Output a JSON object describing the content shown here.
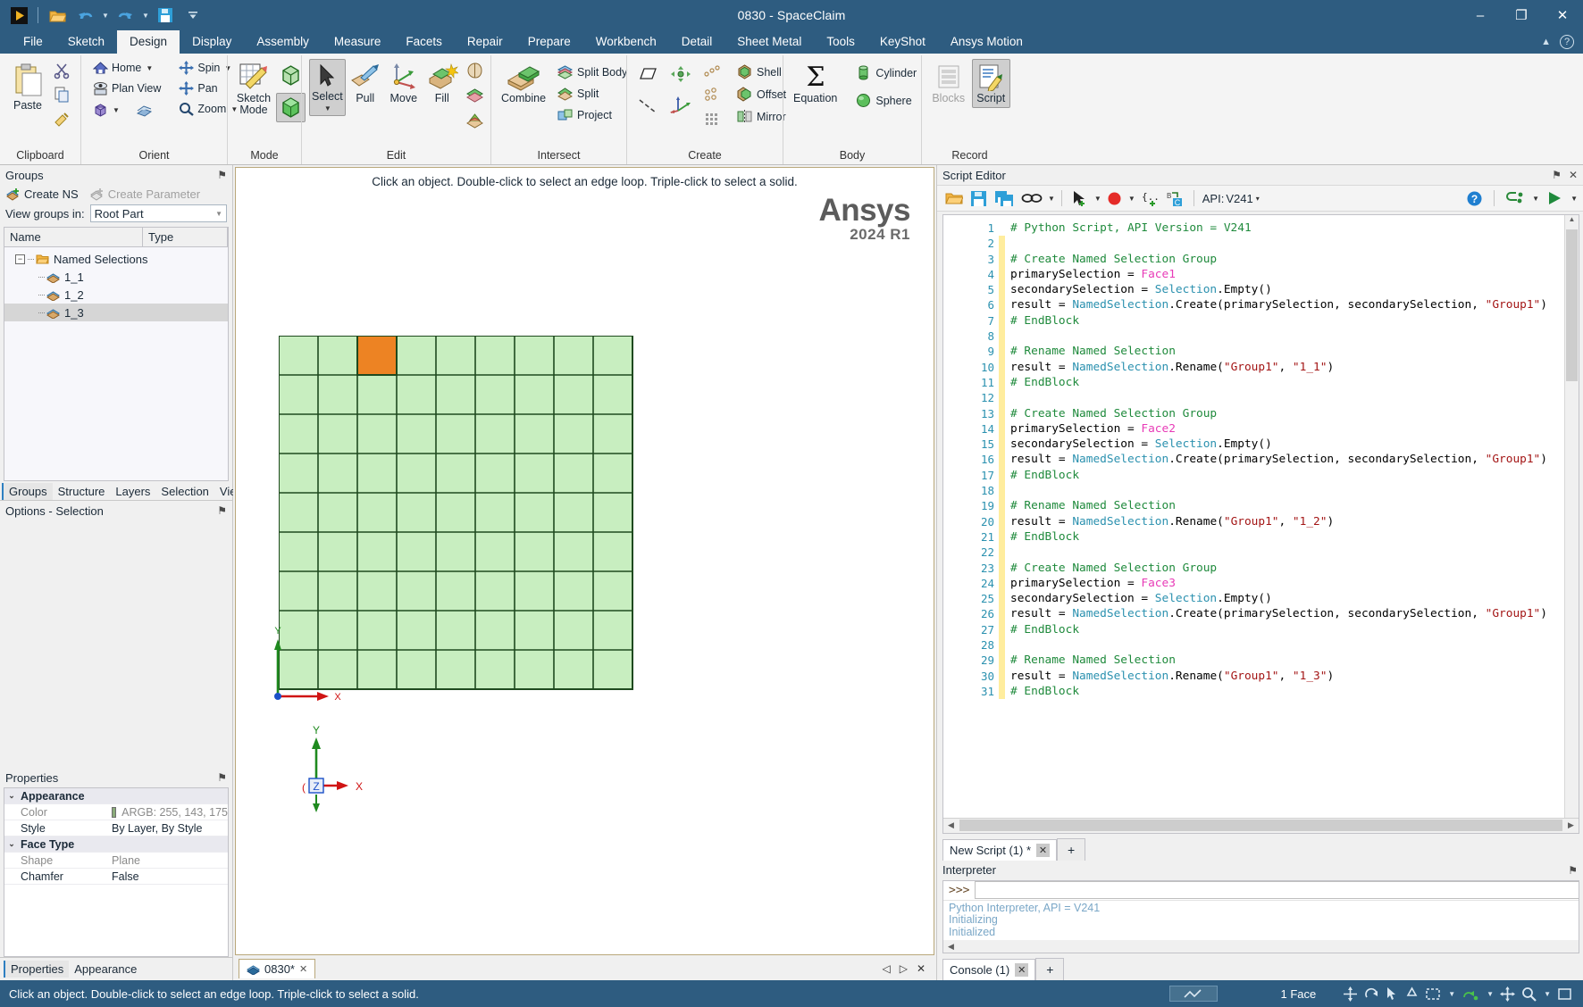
{
  "window": {
    "title": "0830 - SpaceClaim",
    "minimize": "–",
    "maximize": "❐",
    "close": "✕"
  },
  "quick_access": [
    {
      "name": "app-menu-icon",
      "label": "▶"
    },
    {
      "name": "open-icon",
      "label": "folder"
    },
    {
      "name": "undo-icon",
      "label": "undo"
    },
    {
      "name": "redo-icon",
      "label": "redo"
    },
    {
      "name": "save-icon",
      "label": "save"
    },
    {
      "name": "customize-qat-icon",
      "label": "more"
    }
  ],
  "ribbon": {
    "tabs": [
      {
        "label": "File",
        "active": false
      },
      {
        "label": "Sketch",
        "active": false
      },
      {
        "label": "Design",
        "active": true
      },
      {
        "label": "Display",
        "active": false
      },
      {
        "label": "Assembly",
        "active": false
      },
      {
        "label": "Measure",
        "active": false
      },
      {
        "label": "Facets",
        "active": false
      },
      {
        "label": "Repair",
        "active": false
      },
      {
        "label": "Prepare",
        "active": false
      },
      {
        "label": "Workbench",
        "active": false
      },
      {
        "label": "Detail",
        "active": false
      },
      {
        "label": "Sheet Metal",
        "active": false
      },
      {
        "label": "Tools",
        "active": false
      },
      {
        "label": "KeyShot",
        "active": false
      },
      {
        "label": "Ansys Motion",
        "active": false
      }
    ],
    "collapse_icon": "▲",
    "help_icon": "?",
    "groups": [
      {
        "name": "clipboard",
        "label": "Clipboard",
        "big": {
          "label": "Paste",
          "icon": "paste-icon"
        },
        "small": [
          {
            "label": "",
            "icon": "cut-icon"
          },
          {
            "label": "",
            "icon": "copy-icon"
          },
          {
            "label": "",
            "icon": "format-painter-icon"
          }
        ]
      },
      {
        "name": "orient",
        "label": "Orient",
        "items": [
          {
            "label": "Home",
            "icon": "home-icon",
            "dropdown": true
          },
          {
            "label": "Plan View",
            "icon": "plan-view-icon",
            "dropdown": false
          },
          {
            "label": "",
            "icon": "view-cube-icon",
            "dropdown": true
          },
          {
            "label": "",
            "icon": "previous-view-icon",
            "dropdown": false
          },
          {
            "label": "Spin",
            "icon": "spin-icon",
            "dropdown": true
          },
          {
            "label": "Pan",
            "icon": "pan-icon",
            "dropdown": false
          },
          {
            "label": "Zoom",
            "icon": "zoom-icon",
            "dropdown": true
          }
        ]
      },
      {
        "name": "mode",
        "label": "Mode",
        "items": [
          {
            "label": "Sketch Mode",
            "icon": "sketch-mode-icon"
          },
          {
            "label": "",
            "icon": "section-mode-icon"
          },
          {
            "label": "",
            "icon": "solid-mode-icon",
            "pressed": true
          }
        ]
      },
      {
        "name": "edit",
        "label": "Edit",
        "items": [
          {
            "label": "Select",
            "icon": "select-arrow-icon",
            "dropdown": true,
            "pressed": true
          },
          {
            "label": "Pull",
            "icon": "pull-icon"
          },
          {
            "label": "Move",
            "icon": "move-icon"
          },
          {
            "label": "Fill",
            "icon": "fill-icon"
          },
          {
            "label": "",
            "icon": "split-solid-icon"
          },
          {
            "label": "",
            "icon": "blend-icon"
          },
          {
            "label": "",
            "icon": "fill-small-icon"
          }
        ]
      },
      {
        "name": "intersect",
        "label": "Intersect",
        "items": [
          {
            "label": "Combine",
            "icon": "combine-icon"
          },
          {
            "label": "Split Body",
            "icon": "split-body-icon"
          },
          {
            "label": "Split",
            "icon": "split-icon"
          },
          {
            "label": "Project",
            "icon": "project-icon"
          }
        ]
      },
      {
        "name": "create",
        "label": "Create",
        "items": [
          {
            "label": "",
            "icon": "plane-icon"
          },
          {
            "label": "",
            "icon": "line-axis-icon"
          },
          {
            "label": "",
            "icon": "origin-icon"
          },
          {
            "label": "",
            "icon": "axis-icon"
          },
          {
            "label": "",
            "icon": "point-pattern-icon"
          },
          {
            "label": "",
            "icon": "grid-pattern-icon"
          },
          {
            "label": "Shell",
            "icon": "shell-icon"
          },
          {
            "label": "Offset",
            "icon": "offset-icon"
          },
          {
            "label": "Mirror",
            "icon": "mirror-icon"
          }
        ]
      },
      {
        "name": "body",
        "label": "Body",
        "items": [
          {
            "label": "Equation",
            "icon": "sigma-icon"
          },
          {
            "label": "Cylinder",
            "icon": "cylinder-icon"
          },
          {
            "label": "Sphere",
            "icon": "sphere-icon"
          }
        ]
      },
      {
        "name": "record",
        "label": "Record",
        "items": [
          {
            "label": "Blocks",
            "icon": "blocks-icon",
            "disabled": true
          },
          {
            "label": "Script",
            "icon": "script-icon",
            "pressed": true
          }
        ]
      }
    ]
  },
  "groups_panel": {
    "title": "Groups",
    "pin_icon": "⚑",
    "create_ns": "Create NS",
    "create_parameter": "Create Parameter",
    "view_groups_label": "View groups in:",
    "view_groups_value": "Root Part",
    "columns": [
      "Name",
      "Type"
    ],
    "tree": {
      "root_label": "Named Selections",
      "expander": "−",
      "children": [
        {
          "label": "1_1",
          "selected": false
        },
        {
          "label": "1_2",
          "selected": false
        },
        {
          "label": "1_3",
          "selected": true
        }
      ]
    },
    "tabs": [
      {
        "label": "Groups",
        "active": true
      },
      {
        "label": "Structure",
        "active": false
      },
      {
        "label": "Layers",
        "active": false
      },
      {
        "label": "Selection",
        "active": false
      },
      {
        "label": "Views",
        "active": false
      }
    ]
  },
  "options_panel": {
    "title": "Options - Selection",
    "pin_icon": "⚑"
  },
  "properties_panel": {
    "title": "Properties",
    "pin_icon": "⚑",
    "sections": [
      {
        "name": "Appearance",
        "twisty": "⌄",
        "rows": [
          {
            "name": "Color",
            "value": "ARGB: 255, 143, 175",
            "swatch": "#8aab79",
            "dim": true
          },
          {
            "name": "Style",
            "value": "By Layer, By Style",
            "dim": false
          }
        ]
      },
      {
        "name": "Face Type",
        "twisty": "⌄",
        "rows": [
          {
            "name": "Shape",
            "value": "Plane",
            "dim": true
          },
          {
            "name": "Chamfer",
            "value": "False",
            "dim": false
          }
        ]
      }
    ],
    "tabs": [
      {
        "label": "Properties",
        "active": true
      },
      {
        "label": "Appearance",
        "active": false
      }
    ]
  },
  "viewport": {
    "hint": "Click an object. Double-click to select an edge loop. Triple-click to select a solid.",
    "logo_line1": "Ansys",
    "logo_line2": "2024 R1",
    "grid": {
      "cols": 9,
      "rows": 9,
      "fill": "#c8eec0",
      "stroke": "#1f4a1f",
      "highlight_fill": "#ed8323",
      "highlight_col": 2,
      "highlight_row": 0
    },
    "axis_x_label": "X",
    "axis_y_label": "Y",
    "triad": {
      "x": "X",
      "y": "Y",
      "z": "Z"
    },
    "doc_tab": "0830*",
    "doc_tab_close": "✕",
    "nav_prev": "◁",
    "nav_next": "▷",
    "nav_close": "✕"
  },
  "script_editor": {
    "title": "Script Editor",
    "pin_icon": "⚑",
    "close_icon": "✕",
    "toolbar": [
      {
        "name": "open-script-icon",
        "label": "open"
      },
      {
        "name": "save-script-icon",
        "label": "save"
      },
      {
        "name": "save-as-script-icon",
        "label": "save-as"
      },
      {
        "name": "link-icon",
        "label": "link",
        "dropdown": true
      },
      {
        "name": "select-insert-icon",
        "label": "select",
        "dropdown": true
      },
      {
        "name": "record-icon",
        "label": "record",
        "dropdown": true
      },
      {
        "name": "insert-parameter-icon",
        "label": "parameter"
      },
      {
        "name": "convert-to-csharp-icon",
        "label": "convert"
      }
    ],
    "api_label": "API:",
    "api_value": "V241",
    "api_caret": "▾",
    "help_icon": "?",
    "debug_icon": "debug",
    "run_icon": "▶",
    "code_lines": [
      {
        "n": 1,
        "marked": false,
        "tokens": [
          {
            "t": "# Python Script, API Version = V241",
            "c": "c-com"
          }
        ]
      },
      {
        "n": 2,
        "marked": true,
        "tokens": []
      },
      {
        "n": 3,
        "marked": true,
        "tokens": [
          {
            "t": "# Create Named Selection Group",
            "c": "c-com"
          }
        ]
      },
      {
        "n": 4,
        "marked": true,
        "tokens": [
          {
            "t": "primarySelection = ",
            "c": ""
          },
          {
            "t": "Face1",
            "c": "c-ent"
          }
        ]
      },
      {
        "n": 5,
        "marked": true,
        "tokens": [
          {
            "t": "secondarySelection = ",
            "c": ""
          },
          {
            "t": "Selection",
            "c": "c-cls"
          },
          {
            "t": ".Empty()",
            "c": ""
          }
        ]
      },
      {
        "n": 6,
        "marked": true,
        "tokens": [
          {
            "t": "result = ",
            "c": ""
          },
          {
            "t": "NamedSelection",
            "c": "c-cls"
          },
          {
            "t": ".Create(primarySelection, secondarySelection, ",
            "c": ""
          },
          {
            "t": "\"Group1\"",
            "c": "c-str"
          },
          {
            "t": ")",
            "c": ""
          }
        ]
      },
      {
        "n": 7,
        "marked": true,
        "tokens": [
          {
            "t": "# EndBlock",
            "c": "c-com"
          }
        ]
      },
      {
        "n": 8,
        "marked": true,
        "tokens": []
      },
      {
        "n": 9,
        "marked": true,
        "tokens": [
          {
            "t": "# Rename Named Selection",
            "c": "c-com"
          }
        ]
      },
      {
        "n": 10,
        "marked": true,
        "tokens": [
          {
            "t": "result = ",
            "c": ""
          },
          {
            "t": "NamedSelection",
            "c": "c-cls"
          },
          {
            "t": ".Rename(",
            "c": ""
          },
          {
            "t": "\"Group1\"",
            "c": "c-str"
          },
          {
            "t": ", ",
            "c": ""
          },
          {
            "t": "\"1_1\"",
            "c": "c-str"
          },
          {
            "t": ")",
            "c": ""
          }
        ]
      },
      {
        "n": 11,
        "marked": true,
        "tokens": [
          {
            "t": "# EndBlock",
            "c": "c-com"
          }
        ]
      },
      {
        "n": 12,
        "marked": true,
        "tokens": []
      },
      {
        "n": 13,
        "marked": true,
        "tokens": [
          {
            "t": "# Create Named Selection Group",
            "c": "c-com"
          }
        ]
      },
      {
        "n": 14,
        "marked": true,
        "tokens": [
          {
            "t": "primarySelection = ",
            "c": ""
          },
          {
            "t": "Face2",
            "c": "c-ent"
          }
        ]
      },
      {
        "n": 15,
        "marked": true,
        "tokens": [
          {
            "t": "secondarySelection = ",
            "c": ""
          },
          {
            "t": "Selection",
            "c": "c-cls"
          },
          {
            "t": ".Empty()",
            "c": ""
          }
        ]
      },
      {
        "n": 16,
        "marked": true,
        "tokens": [
          {
            "t": "result = ",
            "c": ""
          },
          {
            "t": "NamedSelection",
            "c": "c-cls"
          },
          {
            "t": ".Create(primarySelection, secondarySelection, ",
            "c": ""
          },
          {
            "t": "\"Group1\"",
            "c": "c-str"
          },
          {
            "t": ")",
            "c": ""
          }
        ]
      },
      {
        "n": 17,
        "marked": true,
        "tokens": [
          {
            "t": "# EndBlock",
            "c": "c-com"
          }
        ]
      },
      {
        "n": 18,
        "marked": true,
        "tokens": []
      },
      {
        "n": 19,
        "marked": true,
        "tokens": [
          {
            "t": "# Rename Named Selection",
            "c": "c-com"
          }
        ]
      },
      {
        "n": 20,
        "marked": true,
        "tokens": [
          {
            "t": "result = ",
            "c": ""
          },
          {
            "t": "NamedSelection",
            "c": "c-cls"
          },
          {
            "t": ".Rename(",
            "c": ""
          },
          {
            "t": "\"Group1\"",
            "c": "c-str"
          },
          {
            "t": ", ",
            "c": ""
          },
          {
            "t": "\"1_2\"",
            "c": "c-str"
          },
          {
            "t": ")",
            "c": ""
          }
        ]
      },
      {
        "n": 21,
        "marked": true,
        "tokens": [
          {
            "t": "# EndBlock",
            "c": "c-com"
          }
        ]
      },
      {
        "n": 22,
        "marked": true,
        "tokens": []
      },
      {
        "n": 23,
        "marked": true,
        "tokens": [
          {
            "t": "# Create Named Selection Group",
            "c": "c-com"
          }
        ]
      },
      {
        "n": 24,
        "marked": true,
        "tokens": [
          {
            "t": "primarySelection = ",
            "c": ""
          },
          {
            "t": "Face3",
            "c": "c-ent"
          }
        ]
      },
      {
        "n": 25,
        "marked": true,
        "tokens": [
          {
            "t": "secondarySelection = ",
            "c": ""
          },
          {
            "t": "Selection",
            "c": "c-cls"
          },
          {
            "t": ".Empty()",
            "c": ""
          }
        ]
      },
      {
        "n": 26,
        "marked": true,
        "tokens": [
          {
            "t": "result = ",
            "c": ""
          },
          {
            "t": "NamedSelection",
            "c": "c-cls"
          },
          {
            "t": ".Create(primarySelection, secondarySelection, ",
            "c": ""
          },
          {
            "t": "\"Group1\"",
            "c": "c-str"
          },
          {
            "t": ")",
            "c": ""
          }
        ]
      },
      {
        "n": 27,
        "marked": true,
        "tokens": [
          {
            "t": "# EndBlock",
            "c": "c-com"
          }
        ]
      },
      {
        "n": 28,
        "marked": true,
        "tokens": []
      },
      {
        "n": 29,
        "marked": true,
        "tokens": [
          {
            "t": "# Rename Named Selection",
            "c": "c-com"
          }
        ]
      },
      {
        "n": 30,
        "marked": true,
        "tokens": [
          {
            "t": "result = ",
            "c": ""
          },
          {
            "t": "NamedSelection",
            "c": "c-cls"
          },
          {
            "t": ".Rename(",
            "c": ""
          },
          {
            "t": "\"Group1\"",
            "c": "c-str"
          },
          {
            "t": ", ",
            "c": ""
          },
          {
            "t": "\"1_3\"",
            "c": "c-str"
          },
          {
            "t": ")",
            "c": ""
          }
        ]
      },
      {
        "n": 31,
        "marked": true,
        "tokens": [
          {
            "t": "# EndBlock",
            "c": "c-com"
          }
        ]
      }
    ],
    "script_tab": "New Script (1) *",
    "script_tab_close": "✕",
    "add_tab": "+"
  },
  "interpreter": {
    "title": "Interpreter",
    "pin_icon": "⚑",
    "prompt": ">>>",
    "input_value": "",
    "log": [
      "Python Interpreter, API = V241",
      "Initializing",
      "Initialized"
    ],
    "console_tab": "Console (1)",
    "console_tab_close": "✕",
    "add_tab": "+"
  },
  "status_bar": {
    "message": "Click an object. Double-click to select an edge loop. Triple-click to select a solid.",
    "selection_count": "1 Face",
    "icons": [
      {
        "name": "snap-grid-icon"
      },
      {
        "name": "move-cursor-icon"
      },
      {
        "name": "select-cursor-icon"
      },
      {
        "name": "anchor-icon"
      },
      {
        "name": "section-icon"
      },
      {
        "name": "sketch-plane-icon"
      },
      {
        "name": "pan-status-icon"
      },
      {
        "name": "zoom-status-icon"
      },
      {
        "name": "orient-status-icon"
      },
      {
        "name": "fit-status-icon"
      }
    ]
  },
  "colors": {
    "titlebar": "#2e5c80",
    "accent": "#2e7fc1",
    "face_highlight": "#ed8323",
    "face_fill": "#c8eec0"
  }
}
